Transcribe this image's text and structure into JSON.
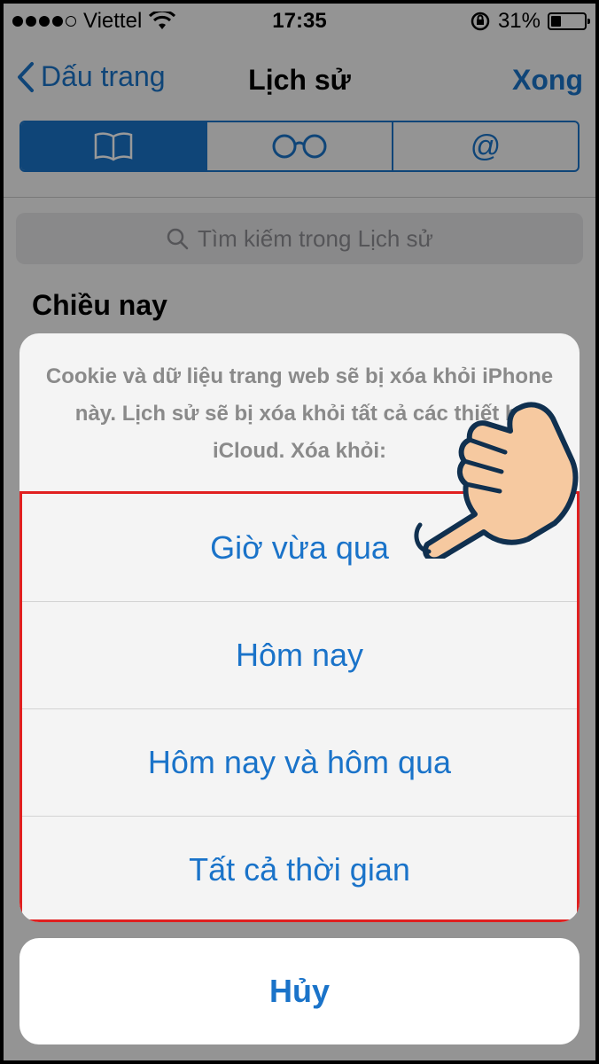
{
  "status_bar": {
    "carrier": "Viettel",
    "time": "17:35",
    "battery_percent_text": "31%",
    "battery_level": 0.31
  },
  "nav": {
    "back_label": "Dấu trang",
    "title": "Lịch sử",
    "done_label": "Xong"
  },
  "segments": [
    {
      "icon": "book-icon",
      "glyph": "📖"
    },
    {
      "icon": "glasses-icon",
      "glyph": "○○"
    },
    {
      "icon": "at-icon",
      "glyph": "@"
    }
  ],
  "search": {
    "placeholder": "Tìm kiếm trong Lịch sử"
  },
  "history": {
    "section_header": "Chiều nay"
  },
  "action_sheet": {
    "message": "Cookie và dữ liệu trang web sẽ bị xóa khỏi iPhone này. Lịch sử sẽ bị xóa khỏi tất cả các thiết bị iCloud. Xóa khỏi:",
    "options": [
      "Giờ vừa qua",
      "Hôm nay",
      "Hôm nay và hôm qua",
      "Tất cả thời gian"
    ],
    "cancel_label": "Hủy"
  },
  "colors": {
    "accent": "#1a73c9",
    "highlight_border": "#e02020"
  }
}
